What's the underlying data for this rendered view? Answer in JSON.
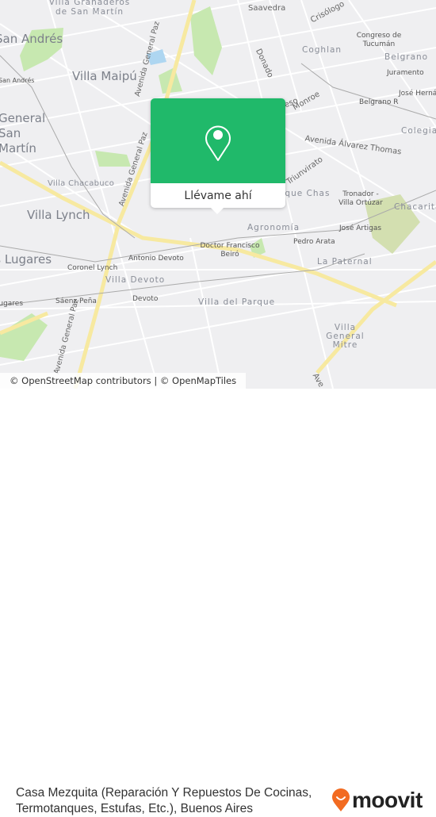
{
  "map": {
    "labels": {
      "villa_granaderos": "Villa Granaderos de San Martín",
      "san_andres": "San Andrés",
      "san_andres_station": "San Andrés",
      "villa_maipu": "Villa Maipú",
      "general_san_martin": "General San Martín",
      "villa_chacabuco": "Villa Chacabuco",
      "villa_lynch": "Villa Lynch",
      "santos_lugares": "Santos Lugares",
      "santos_lugares_station": "Santos Lugares",
      "av_general_paz_1": "Avenida General Paz",
      "av_general_paz_2": "Avenida General Paz",
      "av_general_paz_3": "Avenida General Paz",
      "saavedra": "Saavedra",
      "crisologo": "Crisólogo",
      "donado": "Donado",
      "congreso": "Congreso",
      "monroe": "Monroe",
      "coghlan": "Coghlan",
      "congreso_tucuman": "Congreso de Tucumán",
      "belgrano": "Belgrano",
      "juramento": "Juramento",
      "jose_hernandez": "José Hernández",
      "belgrano_r": "Belgrano R",
      "colegiales": "Colegiales",
      "av_alvarez_thomas": "Avenida Álvarez Thomas",
      "triunvirato": "Triunvirato",
      "parque_chas": "Parque Chas",
      "tronador": "Tronador - Villa Ortúzar",
      "chacarita": "Chacarita",
      "agronomia": "Agronomía",
      "jose_artigas": "José Artigas",
      "pedro_arata": "Pedro Arata",
      "doctor_beiro": "Doctor Francisco Beiró",
      "antonio_devoto": "Antonio Devoto",
      "coronel_lynch": "Coronel Lynch",
      "villa_devoto": "Villa Devoto",
      "saenz_pena": "Sáenz Peña",
      "devoto": "Devoto",
      "villa_del_parque": "Villa del Parque",
      "la_paternal": "La Paternal",
      "villa_general_mitre": "Villa General Mitre",
      "avenida_bottom": "Ave"
    },
    "colors": {
      "land": "#efeff1",
      "road": "#ffffff",
      "major_road": "#f7e9a0",
      "park": "#c7e8b0",
      "park_dark": "#d3dfb0",
      "water": "#aed6f1",
      "rail": "#aaaaaa"
    }
  },
  "popup": {
    "action_label": "Llévame ahí",
    "icon": "map-pin-icon",
    "color": "#20b96a"
  },
  "attribution": "© OpenStreetMap contributors | © OpenMapTiles",
  "place_title": "Casa Mezquita (Reparación Y Repuestos De Cocinas, Termotanques, Estufas, Etc.), Buenos Aires",
  "brand": {
    "name": "moovit",
    "color": "#f26b21"
  }
}
